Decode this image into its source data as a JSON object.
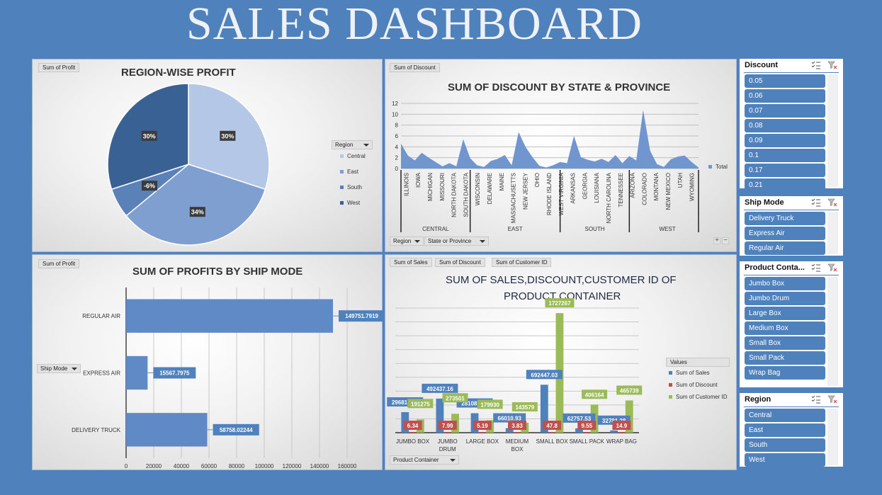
{
  "dashboard": {
    "title": "SALES DASHBOARD"
  },
  "region_panel": {
    "field": "Sum of Profit",
    "title": "REGION-WISE PROFIT",
    "legend_title": "Region"
  },
  "discount_panel": {
    "field": "Sum of Discount",
    "title": "SUM OF DISCOUNT BY STATE & PROVINCE",
    "filter_region": "Region",
    "filter_state": "State or Province",
    "legend": "Total",
    "plus": "+",
    "minus": "−"
  },
  "shipmode_panel": {
    "field": "Sum of Profit",
    "title": "SUM OF PROFITS BY SHIP MODE",
    "filter": "Ship Mode"
  },
  "container_panel": {
    "field_sales": "Sum of Sales",
    "field_discount": "Sum of Discount",
    "field_customer": "Sum of Customer ID",
    "title_line1": "SUM OF SALES,DISCOUNT,CUSTOMER ID OF",
    "title_line2": "PRODUCT CONTAINER",
    "legend_title": "Values",
    "filter": "Product Container"
  },
  "colors": {
    "background": "#4f81bd",
    "pie_central": "#b4c7e7",
    "pie_east": "#7f9fd1",
    "pie_south": "#5b82b8",
    "pie_west": "#3a6194",
    "area": "#7095cf",
    "bar": "#5f8ac6",
    "sales": "#4f81bd",
    "discount": "#c0504d",
    "customer": "#9bbb59"
  },
  "chart_data": [
    {
      "type": "pie",
      "title": "REGION-WISE PROFIT",
      "legend_title": "Region",
      "legend_position": "right",
      "slices": [
        {
          "name": "Central",
          "value": 30,
          "label": "30%"
        },
        {
          "name": "East",
          "value": 34,
          "label": "34%"
        },
        {
          "name": "South",
          "value": -6,
          "label": "-6%"
        },
        {
          "name": "West",
          "value": 30,
          "label": "30%"
        }
      ]
    },
    {
      "type": "area",
      "title": "SUM OF DISCOUNT BY STATE & PROVINCE",
      "ylim": [
        0,
        12
      ],
      "yticks": [
        0,
        2,
        4,
        6,
        8,
        10,
        12
      ],
      "grid": true,
      "legend": [
        "Total"
      ],
      "legend_position": "right",
      "values": [
        4.6,
        2.4,
        1.5,
        2.9,
        2.0,
        1.2,
        0.4,
        1.0,
        0.4,
        5.4,
        1.9,
        0.6,
        0.3,
        1.4,
        1.8,
        2.5,
        0.6,
        6.7,
        4.0,
        2.1,
        0.5,
        0.2,
        0.6,
        1.2,
        1.0,
        6.0,
        2.1,
        1.6,
        1.3,
        1.8,
        1.2,
        2.5,
        1.0,
        2.3,
        1.5,
        10.8,
        3.3,
        0.8,
        0.3,
        1.7,
        2.2,
        2.4,
        1.2,
        0.2
      ],
      "tick_labels": [
        "ILLINOIS",
        "IOWA",
        "MICHIGAN",
        "MISSOURI",
        "NORTH DAKOTA",
        "SOUTH DAKOTA",
        "WISCONSIN",
        "DELAWARE",
        "MAINE",
        "MASSACHUSETTS",
        "NEW JERSEY",
        "OHIO",
        "RHODE ISLAND",
        "WEST VIRGINIA",
        "ARKANSAS",
        "GEORGIA",
        "LOUISIANA",
        "NORTH CAROLINA",
        "TENNESSEE",
        "ARIZONA",
        "COLORADO",
        "MONTANA",
        "NEW MEXICO",
        "UTAH",
        "WYOMING"
      ],
      "groups": [
        {
          "name": "CENTRAL",
          "start": 0,
          "end": 10
        },
        {
          "name": "EAST",
          "start": 10,
          "end": 23
        },
        {
          "name": "SOUTH",
          "start": 23,
          "end": 33
        },
        {
          "name": "WEST",
          "start": 33,
          "end": 44
        }
      ]
    },
    {
      "type": "bar",
      "orientation": "horizontal",
      "title": "SUM OF PROFITS BY SHIP MODE",
      "categories": [
        "REGULAR AIR",
        "EXPRESS AIR",
        "DELIVERY TRUCK"
      ],
      "values": [
        149751.7919,
        15567.7975,
        58758.02244
      ],
      "value_labels": [
        "149751.7919",
        "15567.7975",
        "58758.02244"
      ],
      "xlim": [
        0,
        180000
      ],
      "xticks": [
        0,
        20000,
        40000,
        60000,
        80000,
        100000,
        120000,
        140000,
        160000
      ],
      "grid": true
    },
    {
      "type": "bar",
      "title": "SUM OF SALES,DISCOUNT,CUSTOMER ID OF PRODUCT CONTAINER",
      "categories": [
        "JUMBO BOX",
        "JUMBO DRUM",
        "LARGE BOX",
        "MEDIUM BOX",
        "SMALL BOX",
        "SMALL PACK",
        "WRAP BAG"
      ],
      "category_lines": [
        [
          "JUMBO BOX"
        ],
        [
          "JUMBO",
          "DRUM"
        ],
        [
          "LARGE BOX"
        ],
        [
          "MEDIUM",
          "BOX"
        ],
        [
          "SMALL BOX"
        ],
        [
          "SMALL PACK"
        ],
        [
          "WRAP BAG"
        ]
      ],
      "ylim": [
        0,
        1800000
      ],
      "grid": true,
      "legend_title": "Values",
      "legend_position": "right",
      "series": [
        {
          "name": "Sum of Sales",
          "values": [
            296818.27,
            492437.16,
            281085.68,
            66010.93,
            692447.03,
            62757.53,
            32781.28
          ],
          "labels": [
            "296818.27",
            "492437.16",
            "281085.68",
            "66010.93",
            "692447.03",
            "62757.53",
            "32781.28"
          ]
        },
        {
          "name": "Sum of Discount",
          "values": [
            6.34,
            7.99,
            5.19,
            3.83,
            47.8,
            9.55,
            14.9
          ],
          "labels": [
            "6.34",
            "7.99",
            "5.19",
            "3.83",
            "47.8",
            "9.55",
            "14.9"
          ]
        },
        {
          "name": "Sum of Customer ID",
          "values": [
            191275,
            273501,
            179930,
            143579,
            1727267,
            406164,
            465739
          ],
          "labels": [
            "191275",
            "273501",
            "179930",
            "143579",
            "1727267",
            "406164",
            "465739"
          ]
        }
      ]
    }
  ],
  "slicers": [
    {
      "title": "Discount",
      "items": [
        "0.05",
        "0.06",
        "0.07",
        "0.08",
        "0.09",
        "0.1",
        "0.17",
        "0.21"
      ]
    },
    {
      "title": "Ship Mode",
      "items": [
        "Delivery Truck",
        "Express Air",
        "Regular Air"
      ]
    },
    {
      "title": "Product Conta...",
      "items": [
        "Jumbo Box",
        "Jumbo Drum",
        "Large Box",
        "Medium Box",
        "Small Box",
        "Small Pack",
        "Wrap Bag"
      ]
    },
    {
      "title": "Region",
      "items": [
        "Central",
        "East",
        "South",
        "West"
      ]
    }
  ]
}
